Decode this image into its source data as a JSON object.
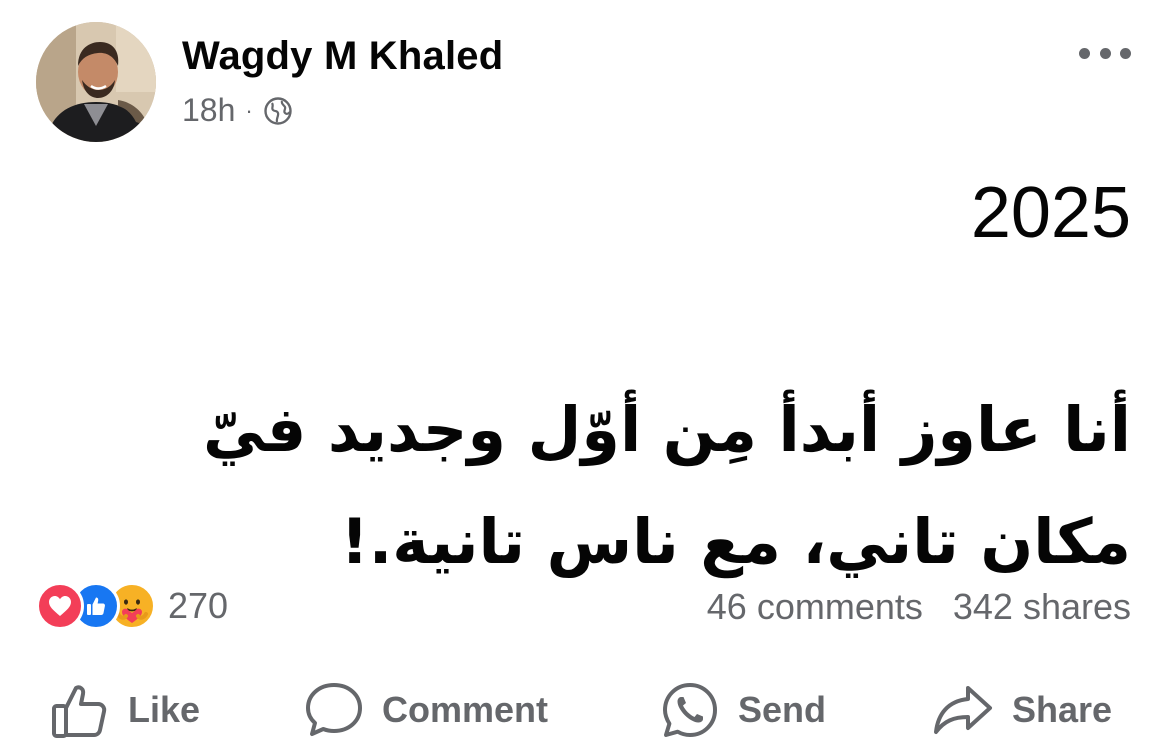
{
  "post": {
    "author": "Wagdy M Khaled",
    "time": "18h",
    "separator": "·",
    "audience_icon": "globe-icon",
    "year": "2025",
    "text": "أنا عاوز أبدأ مِن أوّل وجديد فيّ مكان تاني، مع ناس تانية.!"
  },
  "reactions": {
    "icons": [
      "love-reaction",
      "like-reaction",
      "care-reaction"
    ],
    "count": "270",
    "comments": "46 comments",
    "shares": "342 shares"
  },
  "actions": {
    "like": "Like",
    "comment": "Comment",
    "send": "Send",
    "share": "Share"
  },
  "colors": {
    "text": "#050505",
    "secondary": "#65676b",
    "like_blue": "#1877f2",
    "love_red": "#f33e58",
    "care_yellow": "#f7b125"
  }
}
